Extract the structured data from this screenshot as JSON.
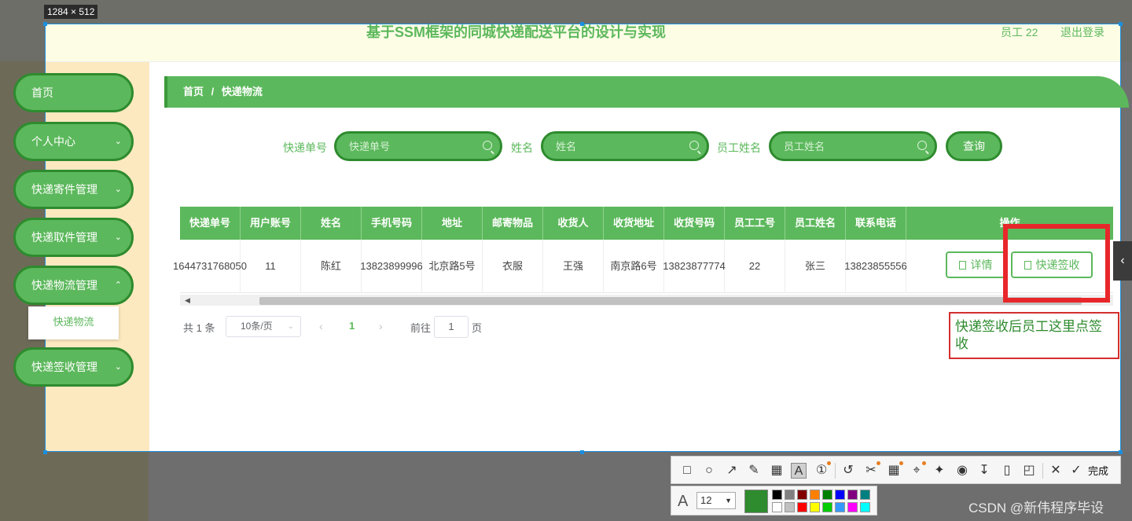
{
  "screenshot_tool": {
    "size_label": "1284 × 512",
    "done_label": "完成",
    "font_size": "12",
    "current_color": "#2e8b2e",
    "tools": [
      "rectangle-icon",
      "ellipse-icon",
      "arrow-icon",
      "pencil-icon",
      "mosaic-icon",
      "text-icon",
      "number-icon",
      "undo-icon",
      "scissors-icon",
      "ocr-icon",
      "scan-icon",
      "pin-icon",
      "record-icon",
      "download-icon",
      "save-icon",
      "bookmark-icon",
      "close-icon",
      "check-icon"
    ],
    "palette": [
      "#000000",
      "#808080",
      "#800000",
      "#ff8000",
      "#008000",
      "#0000ff",
      "#800080",
      "#008080",
      "#ffffff",
      "#c0c0c0",
      "#ff0000",
      "#ffff00",
      "#00cc00",
      "#3399ff",
      "#ff00ff",
      "#00ffff"
    ]
  },
  "header": {
    "title": "基于SSM框架的同城快递配送平台的设计与实现",
    "user": "员工 22",
    "logout": "退出登录"
  },
  "sidebar": {
    "items": [
      {
        "label": "首页"
      },
      {
        "label": "个人中心"
      },
      {
        "label": "快递寄件管理"
      },
      {
        "label": "快递取件管理"
      },
      {
        "label": "快递物流管理"
      },
      {
        "label": "快递签收管理"
      }
    ],
    "submenu_item": "快递物流"
  },
  "breadcrumb": {
    "home": "首页",
    "separator": "/",
    "current": "快递物流"
  },
  "search": {
    "fields": [
      {
        "label": "快递单号",
        "placeholder": "快递单号"
      },
      {
        "label": "姓名",
        "placeholder": "姓名"
      },
      {
        "label": "员工姓名",
        "placeholder": "员工姓名"
      }
    ],
    "button": "查询"
  },
  "table": {
    "headers": [
      "快递单号",
      "用户账号",
      "姓名",
      "手机号码",
      "地址",
      "邮寄物品",
      "收货人",
      "收货地址",
      "收货号码",
      "员工工号",
      "员工姓名",
      "联系电话",
      "操作"
    ],
    "rows": [
      [
        "1644731768050",
        "11",
        "陈红",
        "13823899996",
        "北京路5号",
        "衣服",
        "王强",
        "南京路6号",
        "13823877774",
        "22",
        "张三",
        "13823855556"
      ]
    ],
    "actions": {
      "detail": "详情",
      "sign": "快递签收"
    }
  },
  "pagination": {
    "total": "共 1 条",
    "page_size": "10条/页",
    "current_page": "1",
    "goto_prefix": "前往",
    "goto_value": "1",
    "goto_suffix": "页"
  },
  "annotation": {
    "note": "快递签收后员工这里点签收",
    "highlight_color": "#e8272b"
  },
  "watermark": "CSDN @新伟程序毕设",
  "colors": {
    "accent": "#5cb85c",
    "accent_dark": "#2e8b2e"
  }
}
